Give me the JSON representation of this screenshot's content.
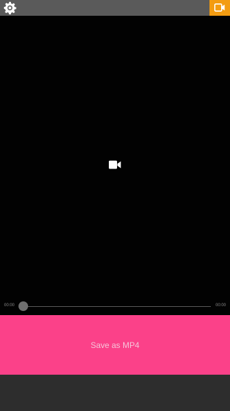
{
  "toolbar": {
    "settings_icon": "gear-icon",
    "camera_icon": "video-camera-icon",
    "accent_color": "#f39c12",
    "bar_color": "#5a5a5a"
  },
  "player": {
    "placeholder_icon": "video-camera-icon",
    "background": "#020202"
  },
  "scrubber": {
    "current_time": "00:00",
    "total_time": "00:00",
    "progress": 0
  },
  "actions": {
    "save_label": "Save as MP4",
    "save_color": "#fb4189"
  }
}
